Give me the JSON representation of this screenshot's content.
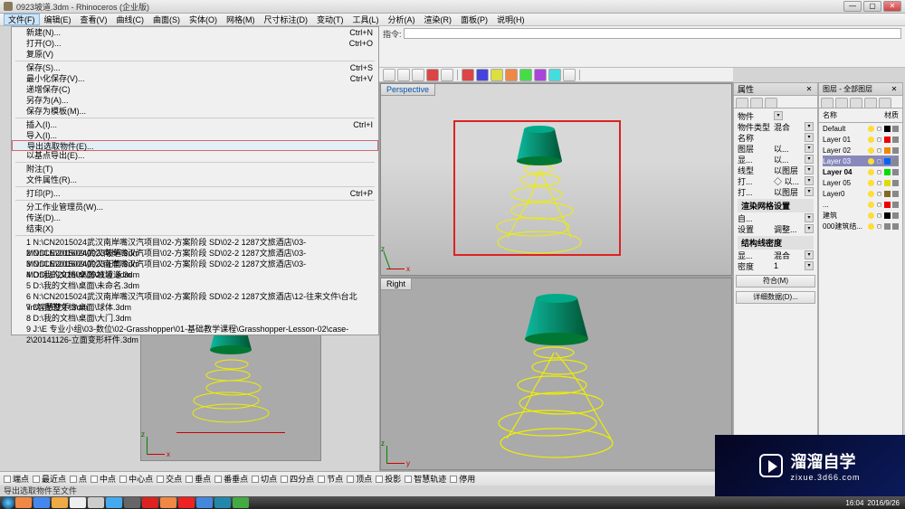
{
  "title": "0923坡道.3dm - Rhinoceros (企业版)",
  "window_controls": {
    "min": "—",
    "max": "▢",
    "close": "✕"
  },
  "menu": [
    "文件(F)",
    "编辑(E)",
    "查看(V)",
    "曲线(C)",
    "曲面(S)",
    "实体(O)",
    "网格(M)",
    "尺寸标注(D)",
    "变动(T)",
    "工具(L)",
    "分析(A)",
    "渲染(R)",
    "面板(P)",
    "说明(H)"
  ],
  "dropdown": {
    "items": [
      {
        "label": "新建(N)...",
        "shortcut": "Ctrl+N"
      },
      {
        "label": "打开(O)...",
        "shortcut": "Ctrl+O"
      },
      {
        "label": "复原(V)"
      },
      {
        "sep": true
      },
      {
        "label": "保存(S)...",
        "shortcut": "Ctrl+S"
      },
      {
        "label": "最小化保存(V)...",
        "shortcut": "Ctrl+V"
      },
      {
        "label": "递增保存(C)"
      },
      {
        "label": "另存为(A)..."
      },
      {
        "label": "保存为模板(M)..."
      },
      {
        "sep": true
      },
      {
        "label": "插入(I)...",
        "shortcut": "Ctrl+I"
      },
      {
        "label": "导入(I)..."
      },
      {
        "label": "导出选取物件(E)...",
        "highlighted": true
      },
      {
        "label": "以基点导出(E)..."
      },
      {
        "sep": true
      },
      {
        "label": "附注(T)"
      },
      {
        "label": "文件属性(R)..."
      },
      {
        "sep": true
      },
      {
        "label": "打印(P)...",
        "shortcut": "Ctrl+P"
      },
      {
        "sep": true
      },
      {
        "label": "分工作业管理员(W)..."
      },
      {
        "label": "传送(D)..."
      },
      {
        "label": "结束(X)"
      },
      {
        "sep": true
      },
      {
        "label": "1 N:\\CN2015024武汉南岸嘴汉汽项目\\02-方案阶段 SD\\02-2 1287文旅酒店\\03-MODLE\\201609\\0923坡道.3dm"
      },
      {
        "label": "2 N:\\CN2015024武汉南岸嘴汉汽项目\\02-方案阶段 SD\\02-2 1287文旅酒店\\03-MODLE\\201609\\0923正面.3dm"
      },
      {
        "label": "3 N:\\CN2015024武汉南岸嘴汉汽项目\\02-方案阶段 SD\\02-2 1287文旅酒店\\03-MODLE\\201609\\0921坡道.3dm"
      },
      {
        "label": "4 D:\\我的文档\\桌面\\坡道.3dm"
      },
      {
        "label": "5 D:\\我的文档\\桌面\\未命名.3dm"
      },
      {
        "label": "6 N:\\CN2015024武汉南岸嘴汉汽项目\\02-方案阶段 SD\\02-2 1287文旅酒店\\12-往来文件\\台北\\in\\智慧雙手.3dm"
      },
      {
        "label": "7 D:\\我的文档\\桌面\\球体.3dm"
      },
      {
        "label": "8 D:\\我的文档\\桌面\\大门.3dm"
      },
      {
        "label": "9 J:\\E 专业小组\\03-数位\\02-Grasshopper\\01-基础教学课程\\Grasshopper-Lesson-02\\case-2\\20141126-立面变形杆件.3dm"
      }
    ]
  },
  "cmd": {
    "label": "指令:",
    "placeholder": ""
  },
  "viewports": {
    "persp": "Perspective",
    "right": "Right"
  },
  "axes": {
    "x": "x",
    "y": "y",
    "z": "z"
  },
  "panels": {
    "props": {
      "title": "属性",
      "type_label": "物件",
      "rows": [
        {
          "k": "物件类型",
          "v": "混合"
        },
        {
          "k": "名称",
          "v": ""
        },
        {
          "k": "图层",
          "v": "以...",
          "color": "#000"
        },
        {
          "k": "显...",
          "v": "以...",
          "color": "#000"
        },
        {
          "k": "线型",
          "v": "以图层"
        },
        {
          "k": "打...",
          "v": "◇ 以..."
        },
        {
          "k": "打...",
          "v": "以图层"
        }
      ],
      "render_title": "渲染网格设置",
      "render_rows": [
        {
          "k": "自...",
          "v": ""
        },
        {
          "k": "设置",
          "v": "调整..."
        }
      ],
      "iso_title": "结构线密度",
      "iso_rows": [
        {
          "k": "显...",
          "v": "混合"
        },
        {
          "k": "密度",
          "v": "1"
        }
      ],
      "buttons": {
        "match": "符合(M)",
        "details": "详细数据(D)..."
      }
    },
    "layers": {
      "title": "图层 - 全部图层",
      "cols": {
        "name": "名称",
        "mat": "材质"
      },
      "items": [
        {
          "name": "Default",
          "color": "sw-black"
        },
        {
          "name": "Layer 01",
          "color": "sw-red"
        },
        {
          "name": "Layer 02",
          "color": "sw-orange"
        },
        {
          "name": "Layer 03",
          "color": "sw-blue",
          "active": true
        },
        {
          "name": "Layer 04",
          "color": "sw-green",
          "bold": true
        },
        {
          "name": "Layer 05",
          "color": "sw-yellow"
        },
        {
          "name": "Layer0",
          "color": "sw-brown"
        },
        {
          "name": "...",
          "color": "sw-red"
        },
        {
          "name": "建筑",
          "color": "sw-black"
        },
        {
          "name": "000建筑结...",
          "color": "sw-gray"
        }
      ]
    }
  },
  "status_checks": [
    "端点",
    "最近点",
    "点",
    "中点",
    "中心点",
    "交点",
    "垂点",
    "番垂点",
    "切点",
    "四分点",
    "节点",
    "顶点",
    "投影",
    "智慧轨迹",
    "停用"
  ],
  "status_msg": "导出选取物件至文件",
  "tray": {
    "time": "16:04",
    "date": "2016/9/26"
  },
  "watermark": {
    "brand": "溜溜自学",
    "url": "zixue.3d66.com"
  }
}
